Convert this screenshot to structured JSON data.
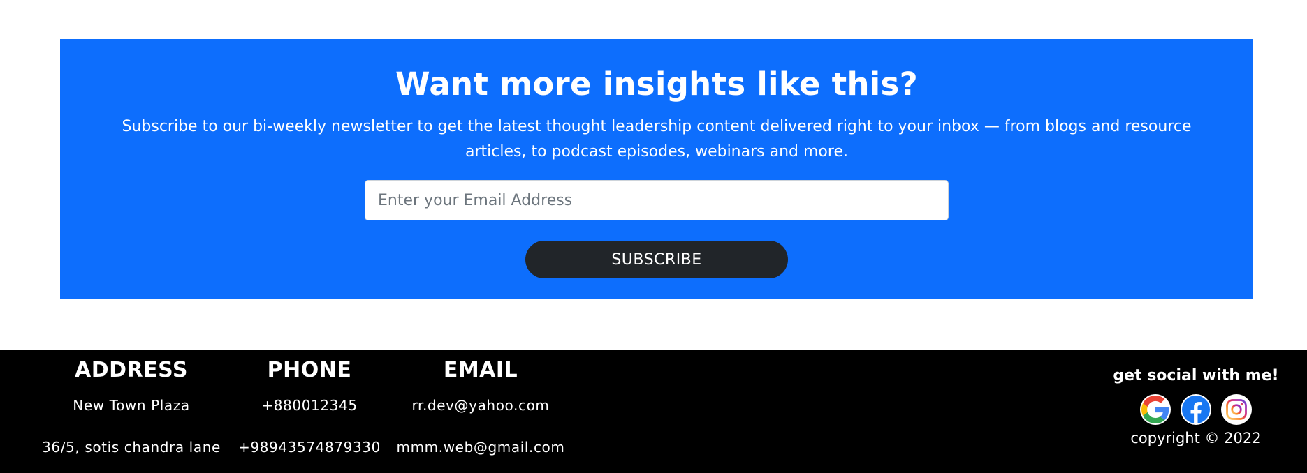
{
  "newsletter": {
    "title": "Want more insights like this?",
    "description": "Subscribe to our bi-weekly newsletter to get the latest thought leadership content delivered right to your inbox — from blogs and resource articles, to podcast episodes, webinars and more.",
    "email_placeholder": "Enter your Email Address",
    "email_value": "",
    "subscribe_label": "SUBSCRIBE",
    "background_color": "#0d6efd",
    "button_color": "#212529"
  },
  "footer": {
    "background_color": "#000000",
    "address": {
      "heading": "ADDRESS",
      "lines": [
        "New Town Plaza",
        "36/5, sotis chandra lane"
      ]
    },
    "phone": {
      "heading": "PHONE",
      "lines": [
        "+880012345",
        "+98943574879330"
      ]
    },
    "email": {
      "heading": "EMAIL",
      "lines": [
        "rr.dev@yahoo.com",
        "mmm.web@gmail.com"
      ]
    },
    "social": {
      "title": "get social with me!",
      "icons": [
        "google-icon",
        "facebook-icon",
        "instagram-icon"
      ],
      "copyright": "copyright © 2022"
    }
  }
}
